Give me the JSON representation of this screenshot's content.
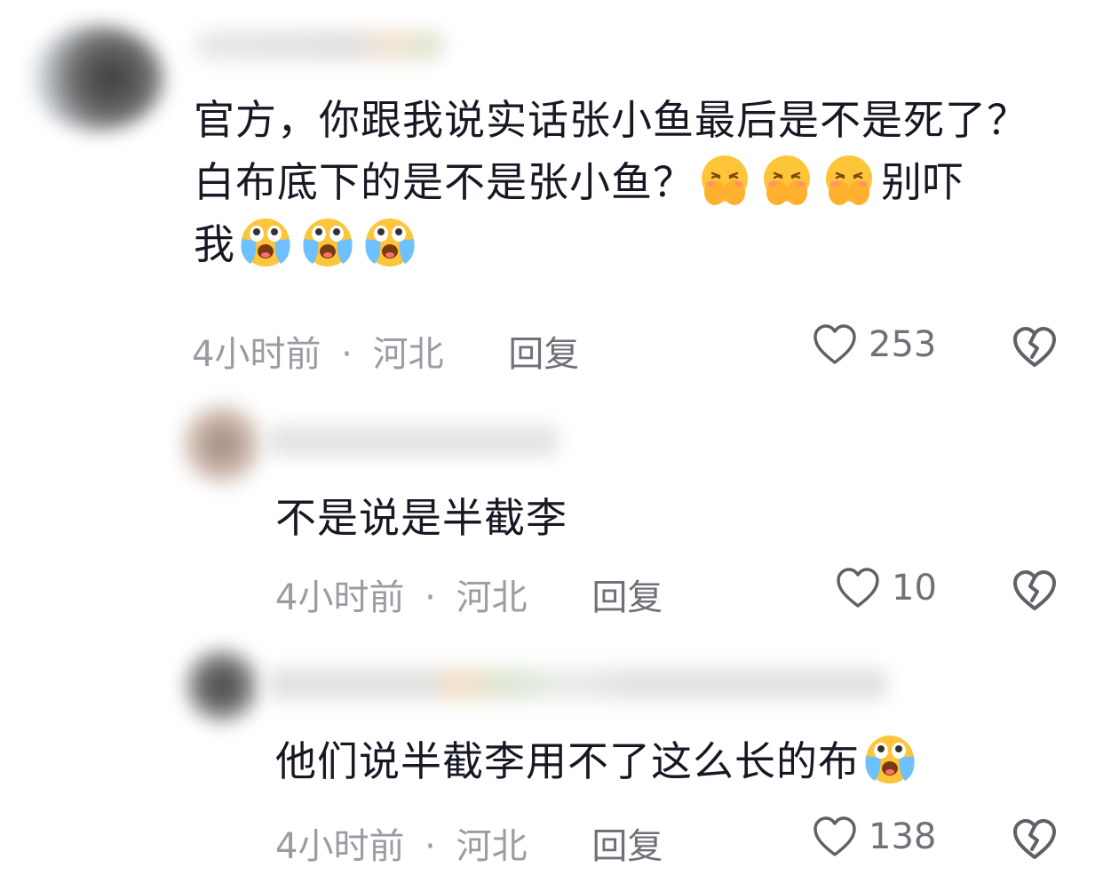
{
  "comments": [
    {
      "text_lines": [
        "官方，你跟我说实话张小鱼最后是不是死了？",
        "白布底下的是不是张小鱼？",
        "别吓",
        "我"
      ],
      "time": "4小时前",
      "location": "河北",
      "reply_label": "回复",
      "likes": "253"
    },
    {
      "text": "不是说是半截李",
      "time": "4小时前",
      "location": "河北",
      "reply_label": "回复",
      "likes": "10"
    },
    {
      "text": "他们说半截李用不了这么长的布",
      "time": "4小时前",
      "location": "河北",
      "reply_label": "回复",
      "likes": "138"
    }
  ],
  "meta_separator": "·",
  "icons": {
    "like": "heart-outline-icon",
    "dislike": "broken-heart-icon",
    "emoji_1": "hands-over-face-emoji",
    "emoji_2": "crying-loudly-emoji"
  },
  "colors": {
    "text": "#161823",
    "meta": "#9a9ca3",
    "emoji": "#ffc53a"
  }
}
